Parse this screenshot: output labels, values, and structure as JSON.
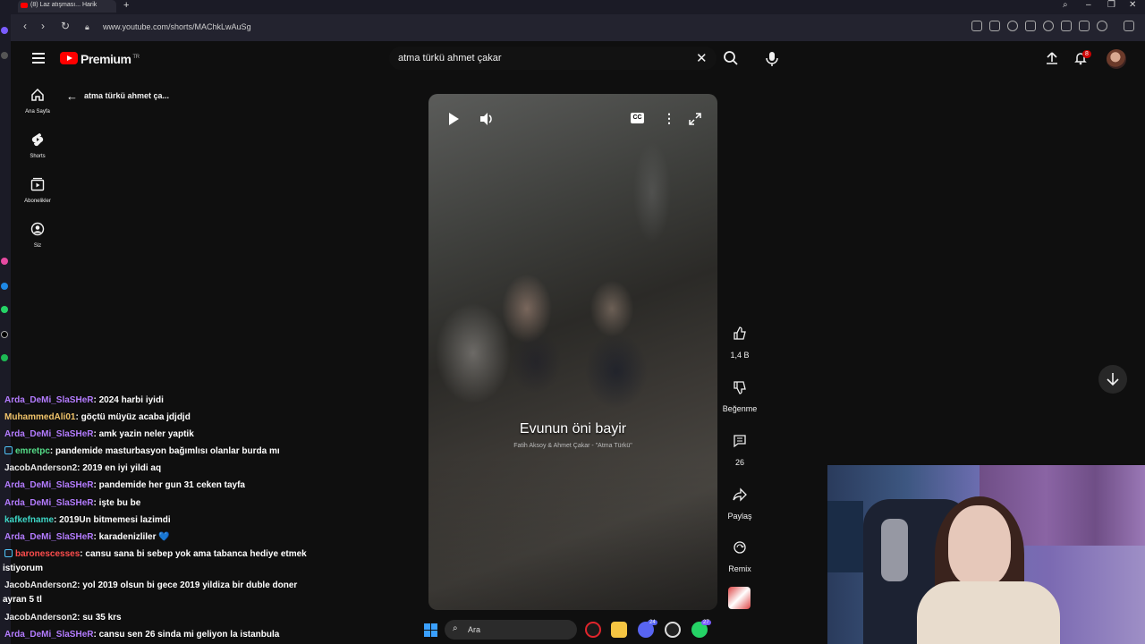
{
  "browser": {
    "tab_title": "(8) Laz atışması... Harik",
    "url": "www.youtube.com/shorts/MAChkLwAuSg"
  },
  "yt": {
    "logo_text": "Premium",
    "logo_sup": "TR",
    "search_query": "atma türkü ahmet çakar",
    "notification_count": "8",
    "back_title": "atma türkü ahmet ça..."
  },
  "nav": [
    {
      "label": "Ana Sayfa",
      "icon": "home-icon"
    },
    {
      "label": "Shorts",
      "icon": "shorts-icon"
    },
    {
      "label": "Abonelikler",
      "icon": "subscriptions-icon"
    },
    {
      "label": "Siz",
      "icon": "you-icon"
    }
  ],
  "video": {
    "caption": "Evunun öni bayir",
    "caption_sub": "Fatih Aksoy & Ahmet Çakar - \"Atma Türkü\""
  },
  "actions": {
    "like_count": "1,4 B",
    "dislike_label": "Beğenme",
    "comment_count": "26",
    "share_label": "Paylaş",
    "remix_label": "Remix"
  },
  "chat": [
    {
      "user": "Arda_DeMi_SlaSHeR",
      "color": "#b47cff",
      "msg": ": 2024 harbi iyidi"
    },
    {
      "user": "MuhammedAli01",
      "color": "#f0c36a",
      "msg": ": göçtü müyüz acaba jdjdjd"
    },
    {
      "user": "Arda_DeMi_SlaSHeR",
      "color": "#b47cff",
      "msg": ": amk yazin neler yaptik"
    },
    {
      "user": "emretpc",
      "color": "#55dd88",
      "msg": ": pandemide masturbasyon bağımlısı olanlar burda mı",
      "icon": true
    },
    {
      "user": "JacobAnderson2",
      "color": "#e8e8e8",
      "msg": ": 2019 en iyi yildi aq"
    },
    {
      "user": "Arda_DeMi_SlaSHeR",
      "color": "#b47cff",
      "msg": ": pandemide her gun 31 ceken tayfa"
    },
    {
      "user": "Arda_DeMi_SlaSHeR",
      "color": "#b47cff",
      "msg": ": işte bu be"
    },
    {
      "user": "kafkefname",
      "color": "#3dd6c6",
      "msg": ": 2019Un bitmemesi lazimdi"
    },
    {
      "user": "Arda_DeMi_SlaSHeR",
      "color": "#b47cff",
      "msg": ": karadenizliler 💙"
    },
    {
      "user": "baronescesses",
      "color": "#ff4d4d",
      "msg": ": cansu sana bi sebep yok ama tabanca hediye etmek",
      "icon": true
    },
    {
      "user": "JacobAnderson2",
      "color": "#e8e8e8",
      "msg": ": yol 2019 olsun bi gece 2019 yildiza bir duble doner"
    },
    {
      "user": "JacobAnderson2",
      "color": "#e8e8e8",
      "msg": ": su 35 krs"
    },
    {
      "user": "Arda_DeMi_SlaSHeR",
      "color": "#b47cff",
      "msg": ": cansu sen 26 sinda mi geliyon la istanbula"
    }
  ],
  "chat_wraps": [
    "istiyorum",
    "ayran 5 tl"
  ],
  "taskbar": {
    "search_placeholder": "Ara",
    "discord_badge": "24",
    "whatsapp_badge": "27"
  },
  "colors": {
    "yt_red": "#ff0000",
    "bg": "#0f0f0f"
  }
}
